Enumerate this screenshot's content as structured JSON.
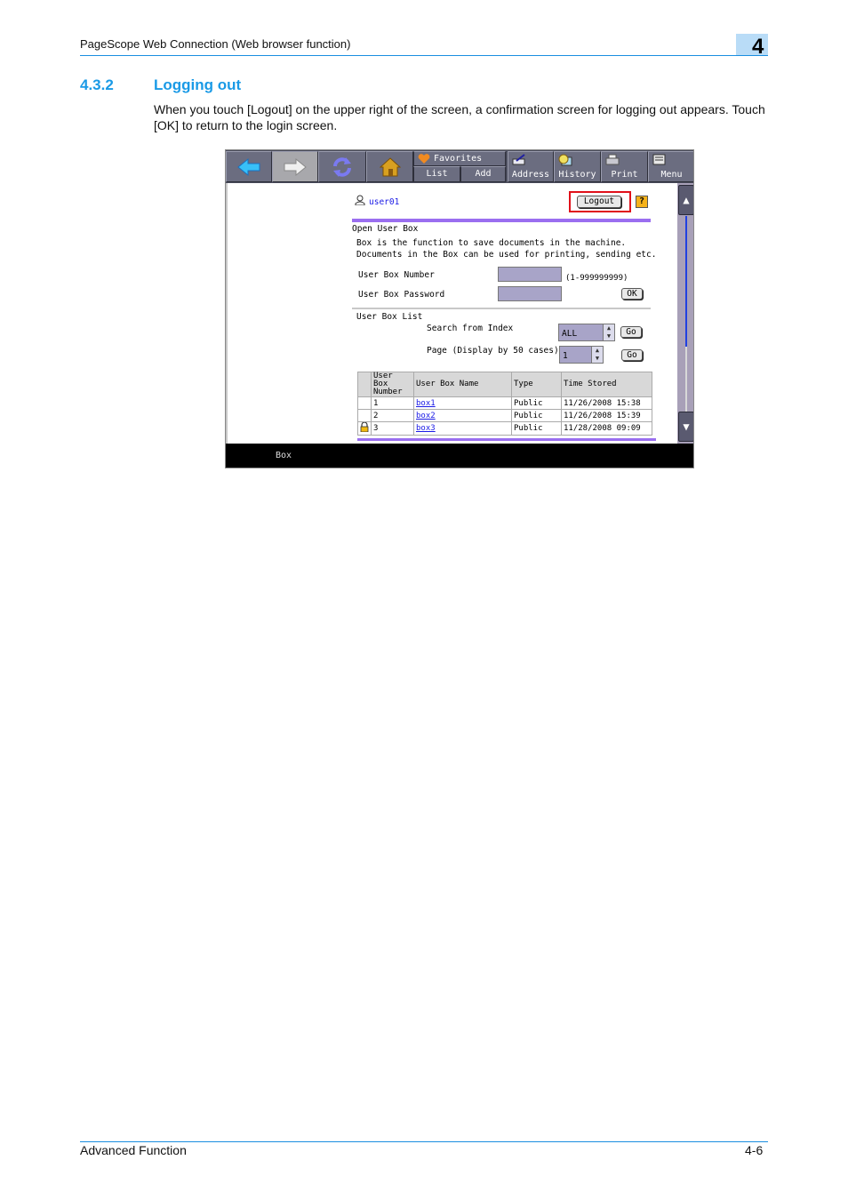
{
  "header": {
    "title": "PageScope Web Connection (Web browser function)",
    "chapter": "4"
  },
  "section": {
    "number": "4.3.2",
    "title": "Logging out",
    "body": "When you touch [Logout] on the upper right of the screen, a confirmation screen for logging out appears. Touch [OK] to return to the login screen."
  },
  "screen": {
    "toolbar": {
      "back_icon": "back-arrow-icon",
      "forward_icon": "forward-arrow-icon",
      "refresh_icon": "refresh-icon",
      "home_icon": "home-icon",
      "favorites_label": "Favorites",
      "list_label": "List",
      "add_label": "Add",
      "address_label": "Address",
      "history_label": "History",
      "print_label": "Print",
      "menu_label": "Menu"
    },
    "user": {
      "name": "user01"
    },
    "logout_label": "Logout",
    "help_label": "?",
    "open_box": {
      "heading": "Open User Box",
      "description_1": "Box is the function to save documents in the machine.",
      "description_2": "Documents in the Box can be used for printing, sending etc.",
      "number_label": "User Box Number",
      "number_value": "",
      "number_range": "(1-999999999)",
      "password_label": "User Box Password",
      "password_value": "",
      "ok_label": "OK"
    },
    "box_list": {
      "heading": "User Box List",
      "search_label": "Search from Index",
      "search_value": "ALL",
      "page_label": "Page (Display by 50 cases)",
      "page_value": "1",
      "go_label": "Go",
      "columns": [
        "User Box Number",
        "User Box Name",
        "Type",
        "Time Stored"
      ],
      "rows": [
        {
          "locked": false,
          "number": "1",
          "name": "box1",
          "type": "Public",
          "time": "11/26/2008 15:38"
        },
        {
          "locked": false,
          "number": "2",
          "name": "box2",
          "type": "Public",
          "time": "11/26/2008 15:39"
        },
        {
          "locked": true,
          "number": "3",
          "name": "box3",
          "type": "Public",
          "time": "11/28/2008 09:09"
        }
      ]
    },
    "status_bar": "Box",
    "colors": {
      "accent_purple": "#9a6ef0",
      "highlight_red": "#e0101a",
      "link_blue": "#1a1ae6"
    }
  },
  "footer": {
    "left": "Advanced Function",
    "right": "4-6"
  }
}
